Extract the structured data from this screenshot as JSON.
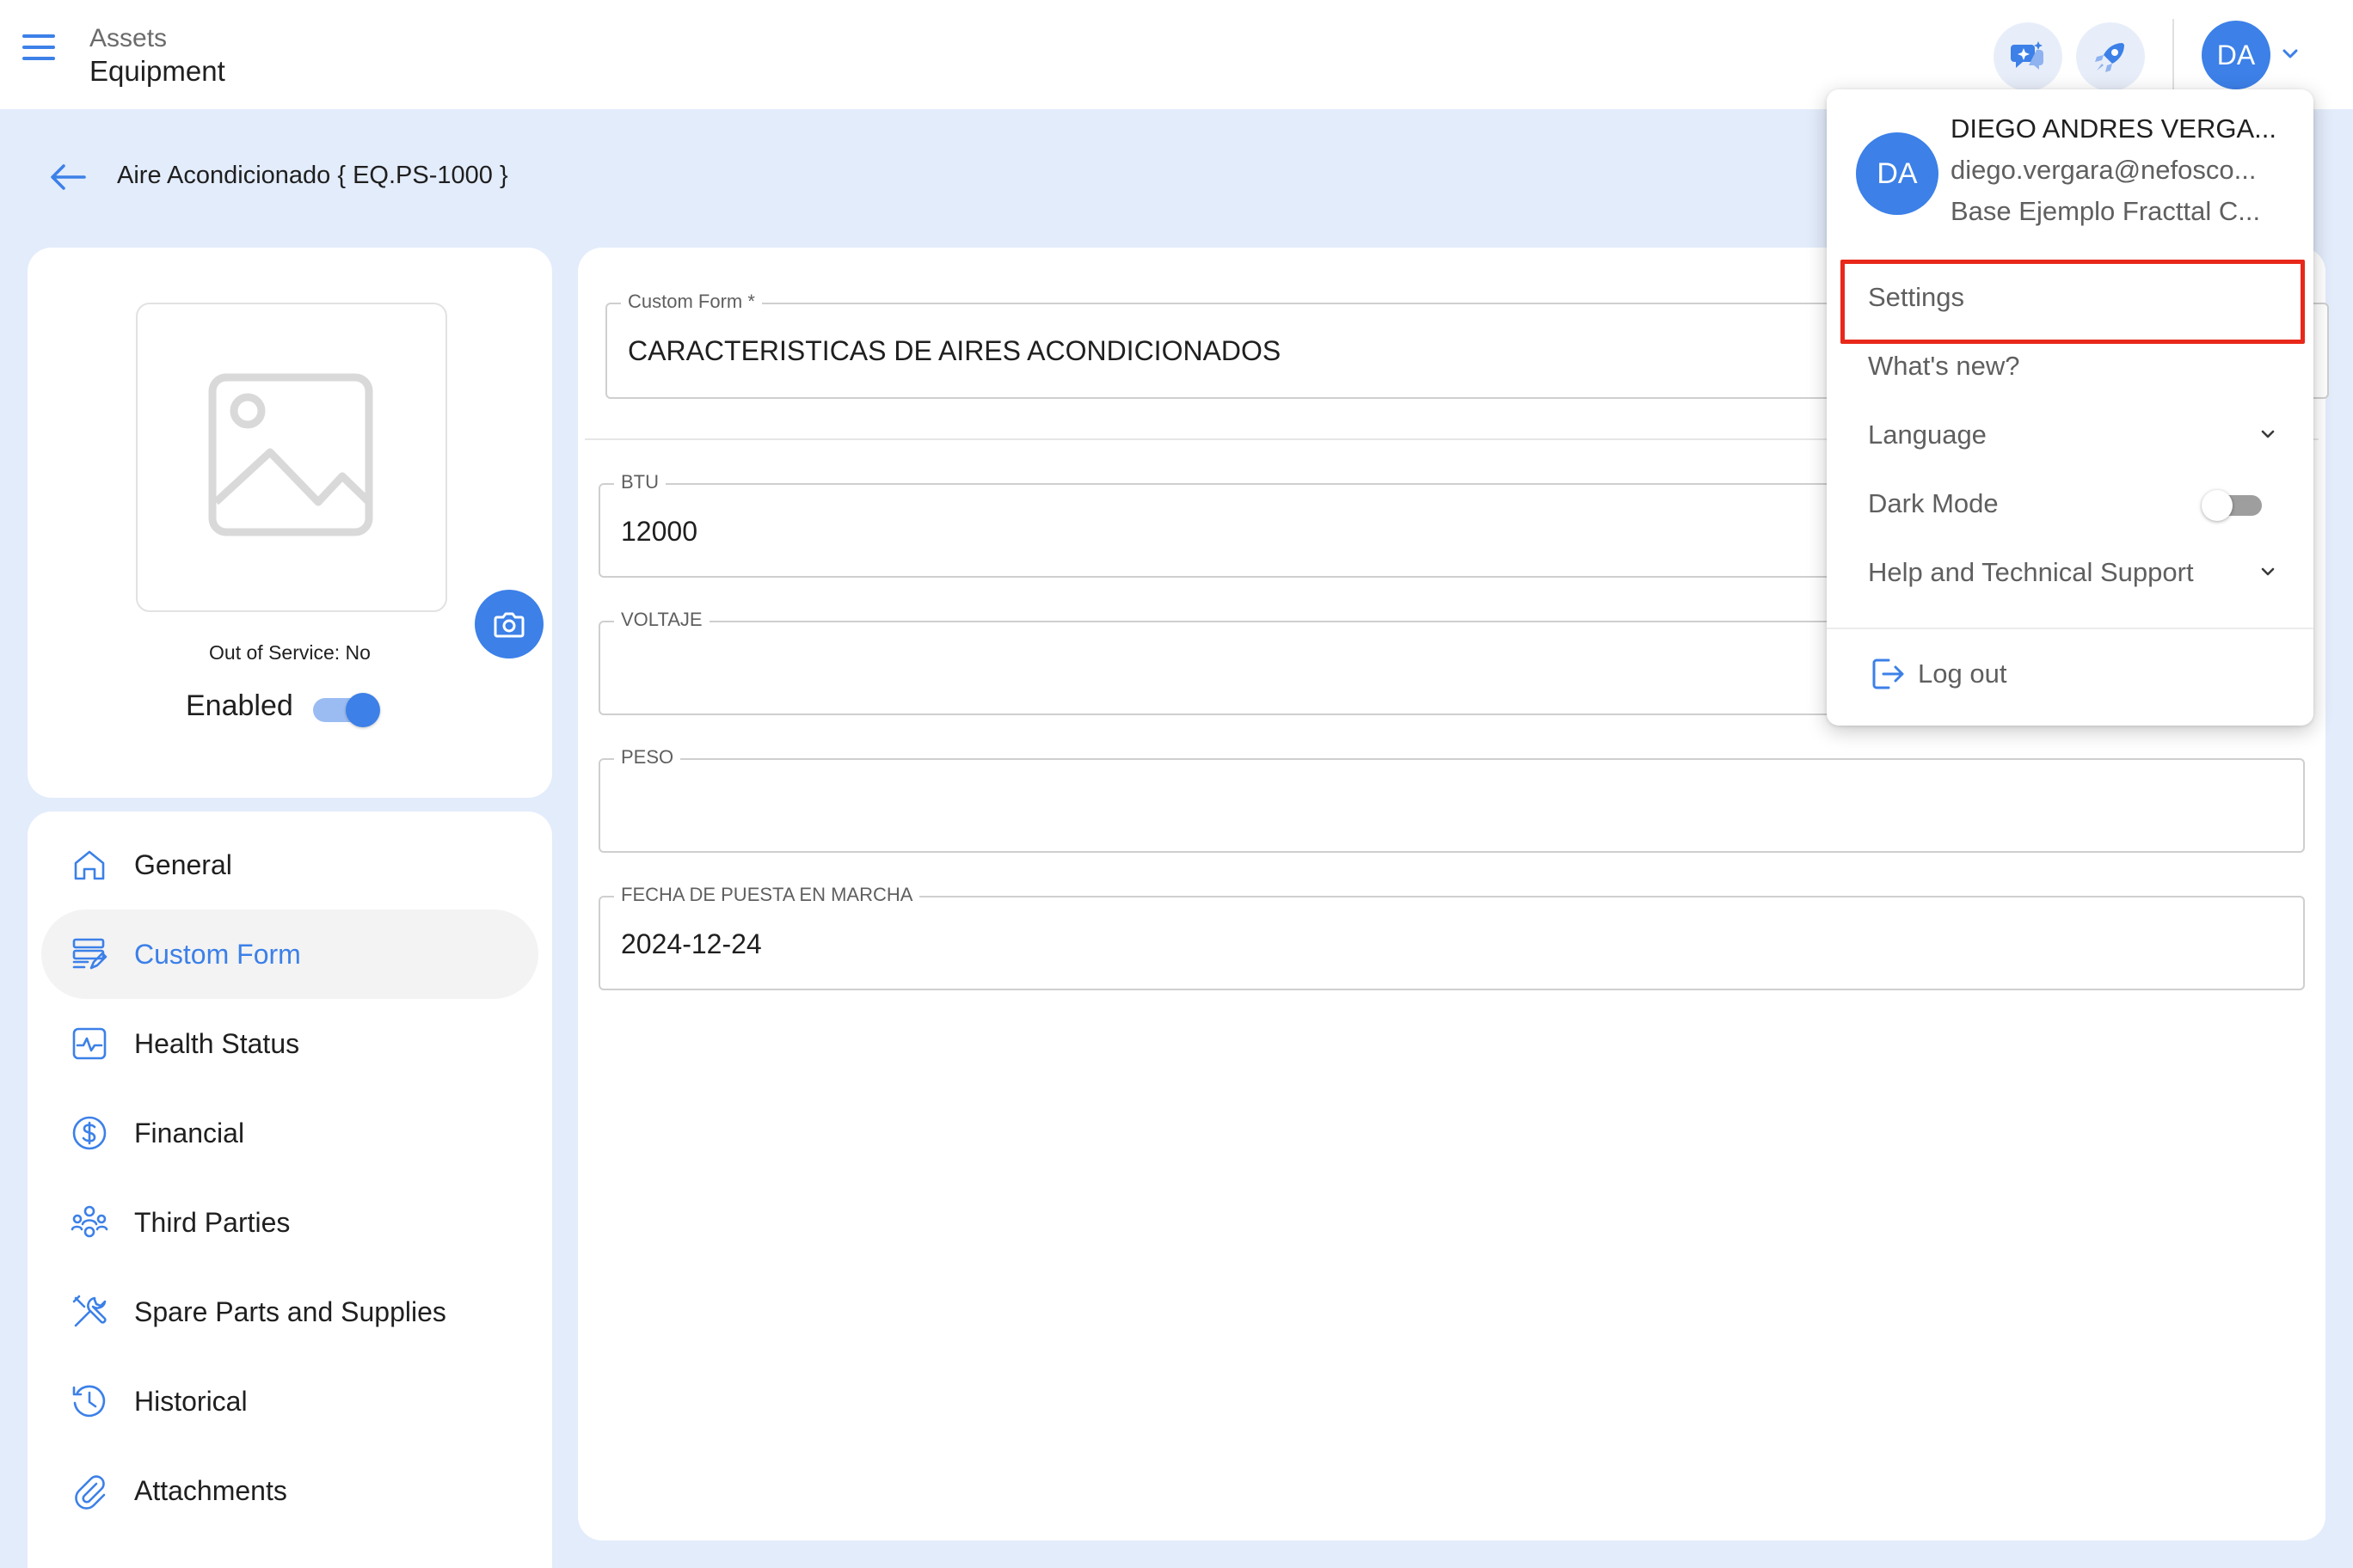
{
  "header": {
    "breadcrumb_parent": "Assets",
    "breadcrumb_current": "Equipment",
    "user_initials": "DA"
  },
  "page": {
    "title": "Aire Acondicionado { EQ.PS-1000 }"
  },
  "asset_card": {
    "out_of_service": "Out of Service: No",
    "enabled_label": "Enabled",
    "enabled": true
  },
  "nav": {
    "items": [
      {
        "label": "General",
        "icon": "home-icon"
      },
      {
        "label": "Custom Form",
        "icon": "form-edit-icon",
        "active": true
      },
      {
        "label": "Health Status",
        "icon": "pulse-icon"
      },
      {
        "label": "Financial",
        "icon": "dollar-icon"
      },
      {
        "label": "Third Parties",
        "icon": "people-icon"
      },
      {
        "label": "Spare Parts and Supplies",
        "icon": "tools-icon"
      },
      {
        "label": "Historical",
        "icon": "history-icon"
      },
      {
        "label": "Attachments",
        "icon": "attachment-icon"
      }
    ]
  },
  "form": {
    "custom_form_label": "Custom Form *",
    "custom_form_value": "CARACTERISTICAS DE AIRES ACONDICIONADOS",
    "fields": [
      {
        "label": "BTU",
        "value": "12000"
      },
      {
        "label": "VOLTAJE",
        "value": ""
      },
      {
        "label": "PESO",
        "value": ""
      },
      {
        "label": "FECHA DE PUESTA EN MARCHA",
        "value": "2024-12-24"
      }
    ]
  },
  "user_menu": {
    "initials": "DA",
    "name": "DIEGO ANDRES VERGA...",
    "email": "diego.vergara@nefosco...",
    "company": "Base Ejemplo Fracttal C...",
    "items": {
      "settings": "Settings",
      "whats_new": "What's new?",
      "language": "Language",
      "dark_mode": "Dark Mode",
      "help": "Help and Technical Support",
      "logout": "Log out"
    },
    "dark_mode_on": false
  },
  "colors": {
    "accent": "#3c80e8",
    "background": "#e3ecfb",
    "highlight": "#e8281a"
  }
}
